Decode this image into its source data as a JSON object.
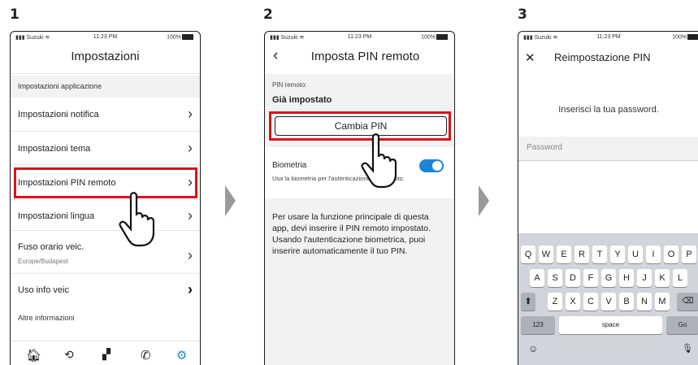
{
  "steps": [
    "1",
    "2",
    "3"
  ],
  "status": {
    "carrier": "Suzuki",
    "time": "11:23 PM",
    "battery": "100%"
  },
  "screen1": {
    "title": "Impostazioni",
    "section_app": "Impostazioni applicazione",
    "items": [
      "Impostazioni notifica",
      "Impostazioni tema",
      "Impostazioni PIN remoto",
      "Impostazioni lingua"
    ],
    "tz_label": "Fuso orario veic.",
    "tz_value": "Europe/Budapest",
    "info_item": "Uso info veic",
    "section_other": "Altre informazioni"
  },
  "screen2": {
    "title": "Imposta PIN remoto",
    "pin_label": "PIN remoto:",
    "pin_status": "Già impostato",
    "change_button": "Cambia PIN",
    "bio_label": "Biometria",
    "bio_desc": "Usa la biometria per l'autenticazione PIN remoto.",
    "bio_enabled": true,
    "info_text": "Per usare la funzione principale di questa app, devi inserire il PIN remoto impostato. Usando l'autenticazione biometrica, puoi inserire automaticamente il tuo PIN."
  },
  "screen3": {
    "title": "Reimpostazione PIN",
    "prompt": "Inserisci la tua password.",
    "password_placeholder": "Password",
    "kb_row1": [
      "Q",
      "W",
      "E",
      "R",
      "T",
      "Y",
      "U",
      "I",
      "O",
      "P"
    ],
    "kb_row2": [
      "A",
      "S",
      "D",
      "F",
      "G",
      "H",
      "J",
      "K",
      "L"
    ],
    "kb_row3": [
      "Z",
      "X",
      "C",
      "V",
      "B",
      "N",
      "M"
    ],
    "key_123": "123",
    "key_space": "space",
    "key_go": "Go"
  },
  "colors": {
    "highlight": "#d7141a",
    "toggle": "#1a86d6",
    "settings_active": "#1a86d6",
    "arrow": "#9a9a9a"
  }
}
